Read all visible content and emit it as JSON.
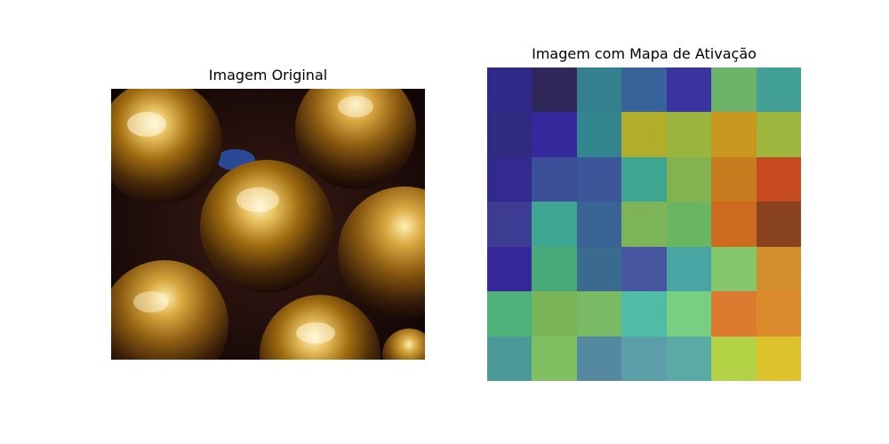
{
  "left_panel": {
    "title": "Imagem Original"
  },
  "right_panel": {
    "title": "Imagem com Mapa de Ativação",
    "overlay_grid": [
      [
        "#2e2a8a",
        "#2f2858",
        "#34808e",
        "#37639a",
        "#3a33a0",
        "#6db46a",
        "#42a097"
      ],
      [
        "#302a80",
        "#35279c",
        "#33858f",
        "#b0ae2a",
        "#9ab43e",
        "#c9961f",
        "#9cb63e"
      ],
      [
        "#34298e",
        "#3b4f99",
        "#3d5599",
        "#3da693",
        "#84b24e",
        "#c67b1f",
        "#c54b1e"
      ],
      [
        "#3b3c92",
        "#3ea693",
        "#3a6396",
        "#7db458",
        "#6bb661",
        "#cc6a1f",
        "#8a4321"
      ],
      [
        "#36289a",
        "#4aaa7a",
        "#3a6a8e",
        "#4656a0",
        "#4aa6a5",
        "#85c66a",
        "#d28e2c"
      ],
      [
        "#4eb27a",
        "#79b457",
        "#7bba64",
        "#50bca5",
        "#77d082",
        "#dc7a30",
        "#dc8b2c"
      ],
      [
        "#4b9a98",
        "#80bf62",
        "#55899f",
        "#5c9eaa",
        "#5caaa6",
        "#b4d246",
        "#dcc22c"
      ]
    ]
  }
}
